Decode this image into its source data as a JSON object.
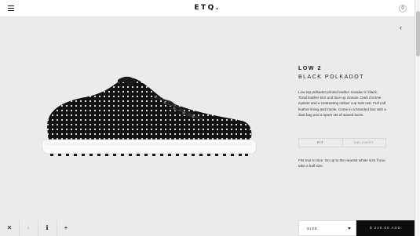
{
  "header": {
    "logo": "ETQ.",
    "cart_count": "0"
  },
  "nav": {
    "back_glyph": "‹"
  },
  "product": {
    "model": "LOW 2",
    "variant": "BLACK POLKADOT",
    "description": "Low top polkadot printed leather sneaker in black. Tonal leather trim and lace-up closure. Dark chrome eyelets and a contrasting rubber cup sole unit. Full calf leather lining and insole. Come in a branded box with a dust bag and a spare set of waxed laces.",
    "tabs": [
      {
        "label": "FIT",
        "active": true
      },
      {
        "label": "DELIVERY",
        "active": false
      }
    ],
    "fit_text": "Fits true to size. Go up to the nearest whole size if you take a half size."
  },
  "bottom_bar": {
    "close_glyph": "✕",
    "prev_glyph": "‹",
    "info_glyph": "ℹ",
    "add_glyph": "+",
    "size_label": "SIZE",
    "add_to_bag_label": "$ 229.00 ADD"
  },
  "colors": {
    "background": "#ebebeb",
    "header": "#ffffff",
    "add_button": "#0c0c0c"
  },
  "icons": [
    "hamburger-icon",
    "cart-icon",
    "back-chevron-icon",
    "close-icon",
    "prev-icon",
    "info-icon",
    "add-icon",
    "caret-down-icon"
  ]
}
